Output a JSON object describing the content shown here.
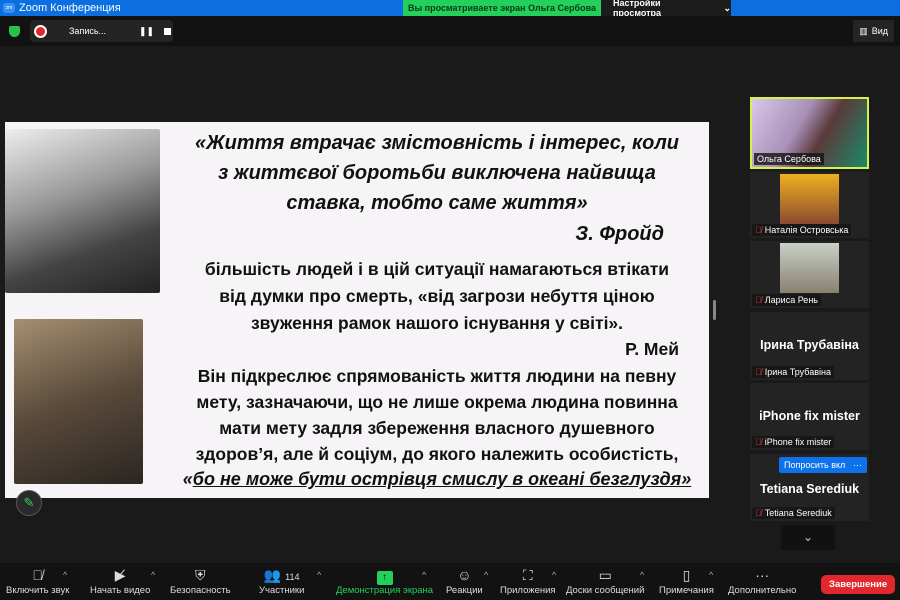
{
  "window": {
    "title": "Zoom Конференция"
  },
  "banner": {
    "viewing": "Вы просматриваете экран Ольга Сербова",
    "view_settings": "Настройки просмотра"
  },
  "recording": {
    "label": "Запись..."
  },
  "view_button": "Вид",
  "slide": {
    "quote1": [
      "«Життя втрачає змістовність і інтерес, коли",
      "з життєвої боротьби виключена найвища",
      "ставка, тобто саме життя»"
    ],
    "author1": "З. Фройд",
    "para1": [
      "більшість людей і в цій ситуації намагаються втікати",
      "від думки про смерть, «від загрози небуття ціною",
      "звуження рамок нашого існування у світі»."
    ],
    "author2": "Р. Мей",
    "para2": [
      "Він підкреслює спрямованість життя людини на певну",
      "мету, зазначаючи, що не лише окрема людина повинна",
      "мати мету задля збереження власного душевного",
      "здоров’я, але й соціум, до якого належить особистість,"
    ],
    "last_open": "«",
    "last_underlined": "бо не може бути острівця смислу в океані безглуздя»"
  },
  "participants": [
    {
      "name": "Ольга Сербова"
    },
    {
      "name": "Наталія Островська"
    },
    {
      "name": "Лариса Рень"
    },
    {
      "name": "Ірина  Трубавіна",
      "display": "Ірина  Трубавіна"
    },
    {
      "name": "iPhone fix mister",
      "display": "iPhone fix mister"
    },
    {
      "name": "Tetiana Serediuk",
      "display": "Tetiana Serediuk"
    }
  ],
  "ask_unmute": "Попросить вкл",
  "more_dots": "···",
  "toolbar": {
    "unmute": "Включить звук",
    "video": "Начать видео",
    "security": "Безопасность",
    "participants": "Участники",
    "participants_count": "114",
    "share": "Демонстрация экрана",
    "reactions": "Реакции",
    "apps": "Приложения",
    "whiteboards": "Доски сообщений",
    "notes": "Примечания",
    "more": "Дополнительно",
    "end": "Завершение"
  },
  "colors": {
    "accent": "#0e72ed",
    "share_green": "#22d05a",
    "end_red": "#e0282e",
    "speaker_border": "#d8f04a"
  }
}
